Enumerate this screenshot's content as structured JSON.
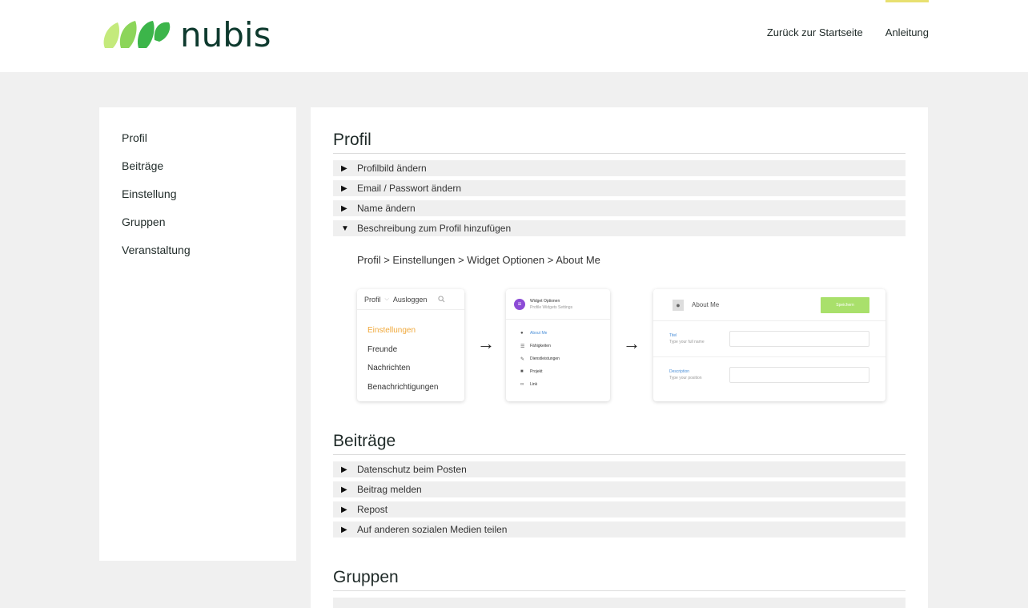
{
  "brand": {
    "logo_text": "nubis",
    "colors": {
      "leaf_light": "#c4ea7c",
      "leaf_mid": "#8cd55a",
      "leaf_dark": "#3cb54a",
      "text": "#0e3a2e"
    }
  },
  "topnav": {
    "links": [
      {
        "label": "Zurück zur Startseite"
      },
      {
        "label": "Anleitung",
        "active": true
      }
    ]
  },
  "sidebar": {
    "items": [
      {
        "label": "Profil"
      },
      {
        "label": "Beiträge"
      },
      {
        "label": "Einstellung"
      },
      {
        "label": "Gruppen"
      },
      {
        "label": "Veranstaltung"
      }
    ]
  },
  "sections": {
    "profil": {
      "title": "Profil",
      "items": [
        {
          "label": "Profilbild ändern",
          "expanded": false
        },
        {
          "label": "Email / Passwort ändern",
          "expanded": false
        },
        {
          "label": "Name ändern",
          "expanded": false
        },
        {
          "label": "Beschreibung zum Profil hinzufügen",
          "expanded": true
        }
      ],
      "expanded_path": "Profil > Einstellungen > Widget Optionen > About Me"
    },
    "beitraege": {
      "title": "Beiträge",
      "items": [
        {
          "label": "Datenschutz beim Posten"
        },
        {
          "label": "Beitrag melden"
        },
        {
          "label": "Repost"
        },
        {
          "label": "Auf anderen sozialen Medien teilen"
        }
      ]
    },
    "gruppen": {
      "title": "Gruppen"
    }
  },
  "shot1": {
    "profil": "Profil",
    "chevron": "⌵",
    "logout": "Ausloggen",
    "menu": [
      "Einstellungen",
      "Freunde",
      "Nachrichten",
      "Benachrichtigungen"
    ]
  },
  "shot2": {
    "title": "Widget Optionen",
    "subtitle": "Profile Widgets Settings",
    "items": [
      "About Me",
      "Fähigkeiten",
      "Dienstleistungen",
      "Projekt",
      "Link"
    ]
  },
  "shot3": {
    "label": "About Me",
    "save": "Speichern",
    "fields": [
      {
        "label": "Titel",
        "placeholder": "Type your full name"
      },
      {
        "label": "Description",
        "placeholder": "Type your position"
      }
    ]
  },
  "icons": {
    "collapsed": "▶",
    "expanded": "▼",
    "arrow": "→"
  }
}
